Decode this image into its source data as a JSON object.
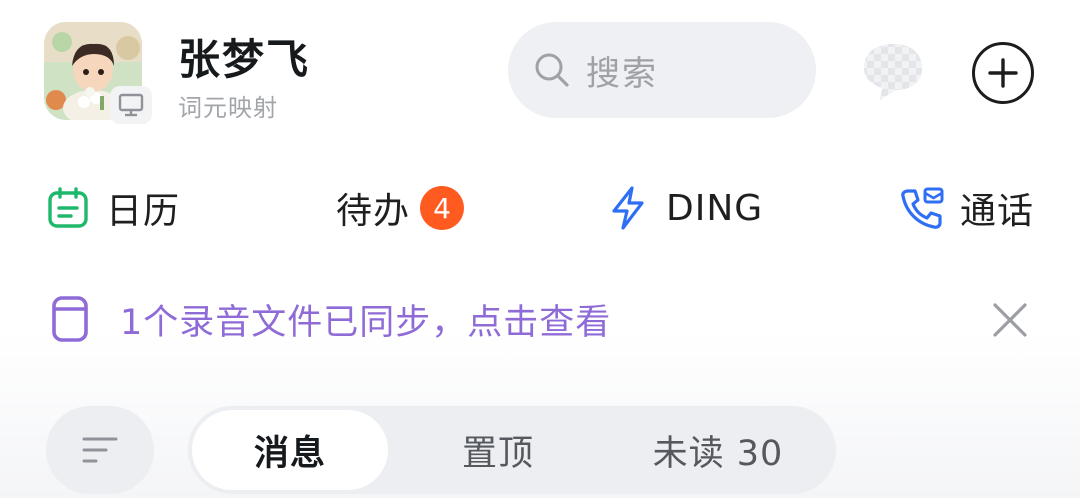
{
  "header": {
    "user_name": "张梦飞",
    "org_name": "词元映射",
    "avatar_icon": "avatar-illustration",
    "device_icon": "desktop-monitor-icon",
    "search_placeholder": "搜索",
    "ai_icon": "ai-assistant-bubble-icon",
    "add_icon": "plus-circle-icon"
  },
  "quick_actions": {
    "calendar_label": "日历",
    "todo_label": "待办",
    "todo_count": "4",
    "ding_label": "DING",
    "call_label": "通话"
  },
  "notice": {
    "text": "1个录音文件已同步，点击查看"
  },
  "filter": {
    "tabs": [
      {
        "label": "消息"
      },
      {
        "label": "置顶"
      },
      {
        "label": "未读 30"
      }
    ]
  },
  "colors": {
    "calendar": "#1fb86b",
    "todo_badge": "#ff5a1f",
    "ding": "#2f6ff5",
    "call": "#2f6ff5",
    "notice": "#8e6bd6"
  }
}
